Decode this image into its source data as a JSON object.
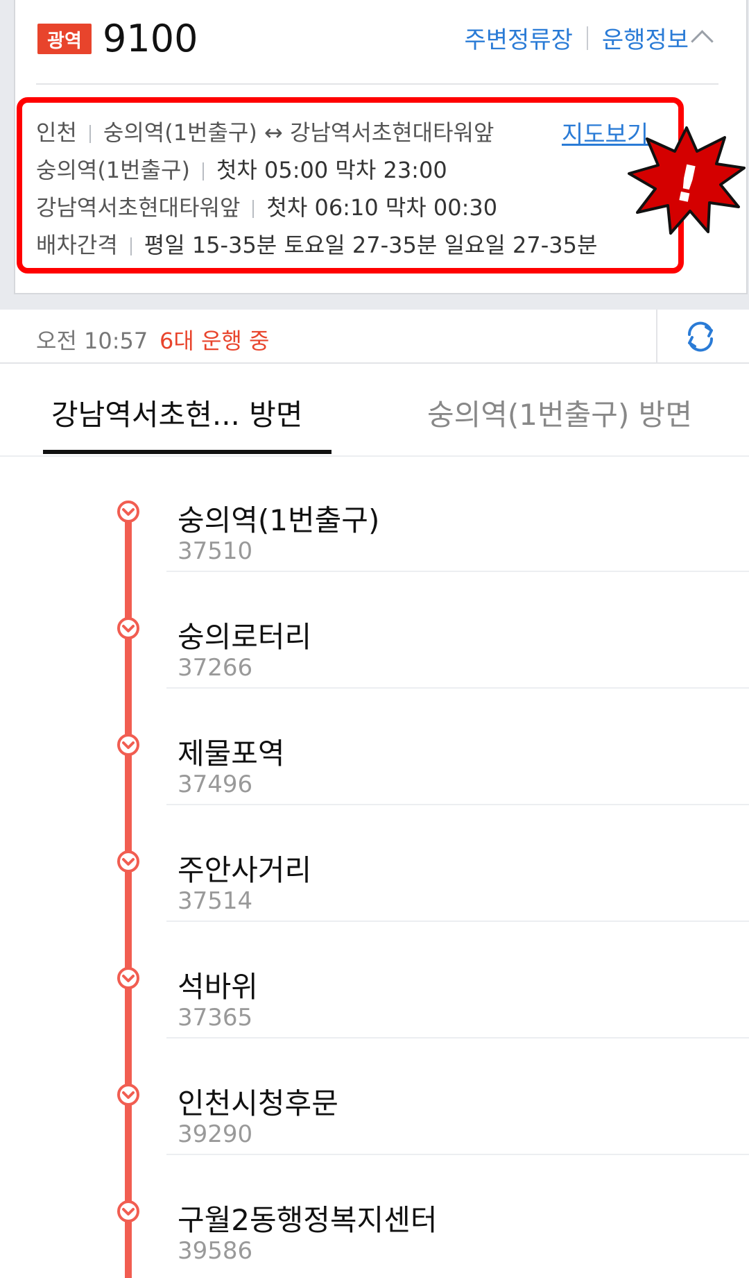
{
  "header": {
    "badge": "광역",
    "route_number": "9100",
    "links": [
      "주변정류장",
      "운행정보"
    ]
  },
  "info": {
    "region": "인천",
    "route": "숭의역(1번출구) ↔ 강남역서초현대타워앞",
    "map_link": "지도보기",
    "schedule": [
      {
        "stop": "숭의역(1번출구)",
        "text": "첫차 05:00 막차 23:00"
      },
      {
        "stop": "강남역서초현대타워앞",
        "text": "첫차 06:10 막차 00:30"
      }
    ],
    "interval_label": "배차간격",
    "interval_text": "평일 15-35분 토요일 27-35분 일요일 27-35분"
  },
  "status": {
    "time": "오전 10:57",
    "running": "6대 운행 중"
  },
  "tabs": [
    {
      "label": "강남역서초현...  방면",
      "active": true
    },
    {
      "label": "숭의역(1번출구) 방면",
      "active": false
    }
  ],
  "stops": [
    {
      "name": "숭의역(1번출구)",
      "code": "37510"
    },
    {
      "name": "숭의로터리",
      "code": "37266"
    },
    {
      "name": "제물포역",
      "code": "37496"
    },
    {
      "name": "주안사거리",
      "code": "37514"
    },
    {
      "name": "석바위",
      "code": "37365"
    },
    {
      "name": "인천시청후문",
      "code": "39290"
    },
    {
      "name": "구월2동행정복지센터",
      "code": "39586"
    }
  ],
  "colors": {
    "accent_red": "#e8442c",
    "link_blue": "#2a7bd6",
    "route_line": "#f15d51",
    "highlight_border": "#ff0000"
  },
  "icons": [
    "chevron-up-icon",
    "alert-burst-icon",
    "refresh-icon",
    "stop-marker-icon"
  ]
}
